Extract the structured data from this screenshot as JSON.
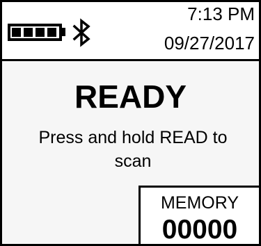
{
  "header": {
    "battery_icon": "battery-full-icon",
    "battery_level": 1.0,
    "bluetooth_icon": "bluetooth-icon",
    "time": "7:13 PM",
    "date": "09/27/2017"
  },
  "main": {
    "status": "READY",
    "message": "Press and hold READ to scan"
  },
  "memory": {
    "label": "MEMORY",
    "value": "00000"
  },
  "colors": {
    "text": "#000000",
    "background": "#f6f6f6",
    "panel": "#ffffff"
  }
}
